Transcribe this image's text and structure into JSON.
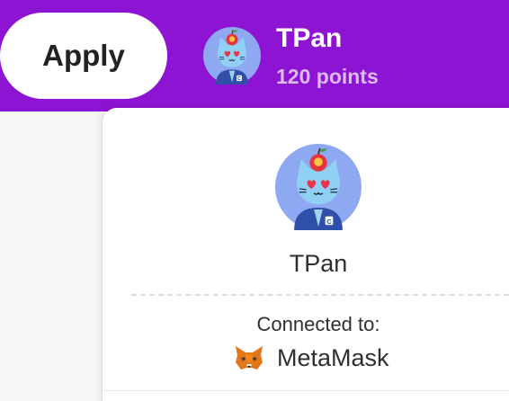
{
  "header": {
    "apply_label": "Apply",
    "username": "TPan",
    "points": "120 points",
    "brand_color": "#8e14d4",
    "avatar_icon": "cat-avatar-icon"
  },
  "account_panel": {
    "username": "TPan",
    "connected_label": "Connected to:",
    "wallet_name": "MetaMask",
    "wallet_icon": "metamask-fox-icon"
  }
}
